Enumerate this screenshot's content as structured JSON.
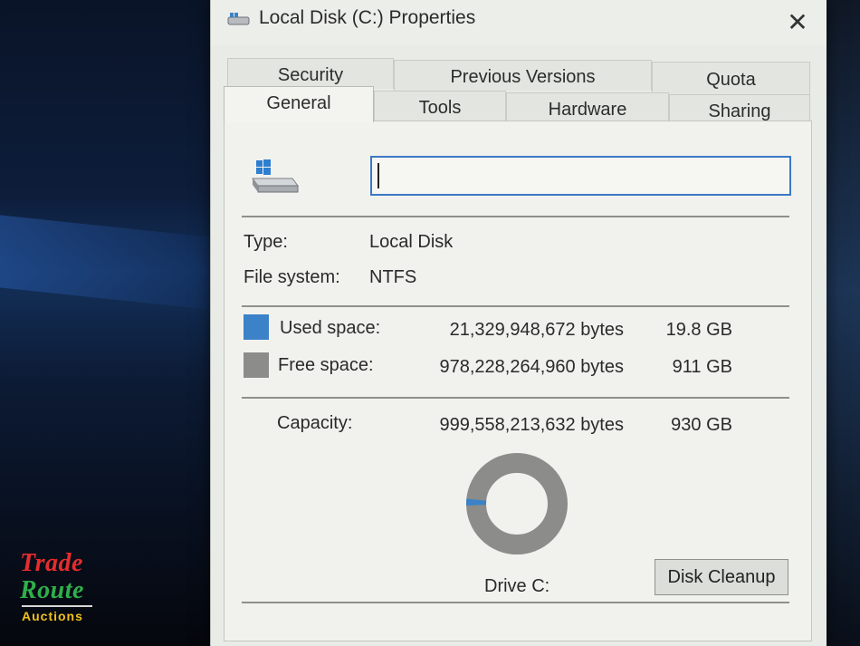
{
  "window": {
    "title": "Local Disk (C:) Properties",
    "close_glyph": "✕"
  },
  "tabs": {
    "row_back": [
      "Security",
      "Previous Versions",
      "Quota"
    ],
    "row_front": [
      "General",
      "Tools",
      "Hardware",
      "Sharing"
    ],
    "active": "General"
  },
  "general": {
    "volume_label_value": "",
    "type_label": "Type:",
    "type_value": "Local Disk",
    "fs_label": "File system:",
    "fs_value": "NTFS",
    "used": {
      "label": "Used space:",
      "bytes": "21,329,948,672 bytes",
      "size": "19.8 GB",
      "color": "#3c82c8"
    },
    "free": {
      "label": "Free space:",
      "bytes": "978,228,264,960 bytes",
      "size": "911 GB",
      "color": "#8c8c8a"
    },
    "capacity": {
      "label": "Capacity:",
      "bytes": "999,558,213,632 bytes",
      "size": "930 GB"
    },
    "usage_fraction": 0.0213,
    "drive_label": "Drive C:",
    "cleanup_button": "Disk Cleanup"
  },
  "watermark": {
    "line1": "Trade",
    "line2": "Route",
    "line3": "Auctions"
  },
  "icons": {
    "title": "drive-icon",
    "drive": "windows-drive-icon",
    "close": "close-icon"
  }
}
